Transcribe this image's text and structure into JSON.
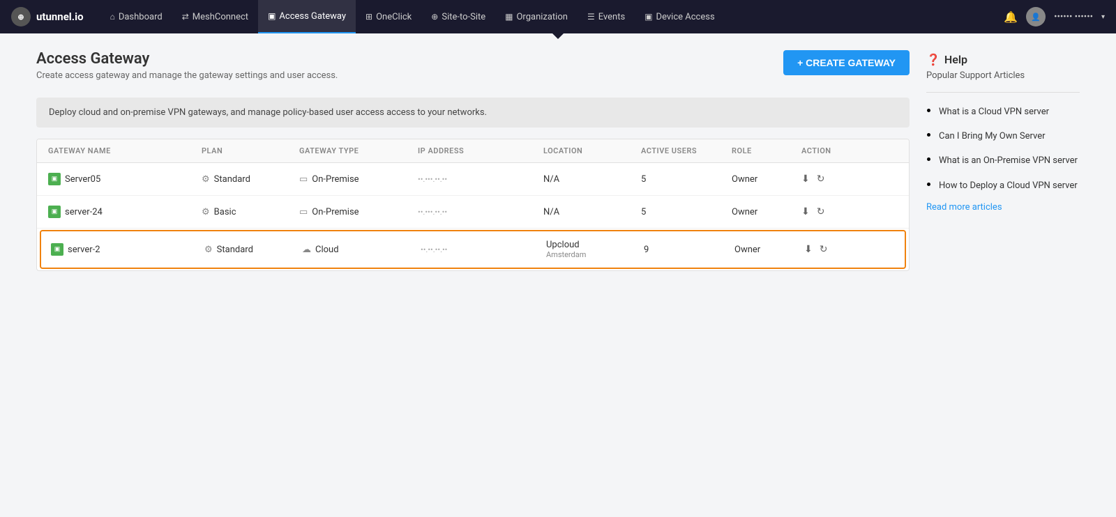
{
  "app": {
    "logo_text": "utunnel.io",
    "logo_icon": "⊕"
  },
  "nav": {
    "items": [
      {
        "id": "dashboard",
        "label": "Dashboard",
        "icon": "⌂",
        "active": false
      },
      {
        "id": "meshconnect",
        "label": "MeshConnect",
        "icon": "⇄",
        "active": false
      },
      {
        "id": "access-gateway",
        "label": "Access Gateway",
        "icon": "▣",
        "active": true
      },
      {
        "id": "oneclick",
        "label": "OneClick",
        "icon": "⊞",
        "active": false
      },
      {
        "id": "site-to-site",
        "label": "Site-to-Site",
        "icon": "⊕",
        "active": false
      },
      {
        "id": "organization",
        "label": "Organization",
        "icon": "▦",
        "active": false
      },
      {
        "id": "events",
        "label": "Events",
        "icon": "☰",
        "active": false
      },
      {
        "id": "device-access",
        "label": "Device Access",
        "icon": "▣",
        "active": false
      }
    ],
    "username": "••••••  ••••••",
    "bell_label": "🔔"
  },
  "page": {
    "title": "Access Gateway",
    "subtitle": "Create access gateway and manage the gateway settings and user access.",
    "create_button": "+ CREATE GATEWAY",
    "info_banner": "Deploy cloud and on-premise VPN gateways, and manage policy-based user access access to your networks."
  },
  "table": {
    "columns": [
      "GATEWAY NAME",
      "PLAN",
      "GATEWAY TYPE",
      "IP ADDRESS",
      "LOCATION",
      "ACTIVE USERS",
      "ROLE",
      "ACTION"
    ],
    "rows": [
      {
        "id": "row1",
        "name": "Server05",
        "plan": "Standard",
        "gateway_type": "On-Premise",
        "ip_address": "••.•••.••.••",
        "location": "N/A",
        "location_sub": "",
        "active_users": "5",
        "role": "Owner",
        "selected": false
      },
      {
        "id": "row2",
        "name": "server-24",
        "plan": "Basic",
        "gateway_type": "On-Premise",
        "ip_address": "••.•••.••.••",
        "location": "N/A",
        "location_sub": "",
        "active_users": "5",
        "role": "Owner",
        "selected": false
      },
      {
        "id": "row3",
        "name": "server-2",
        "plan": "Standard",
        "gateway_type": "Cloud",
        "ip_address": "••.••.••.••",
        "location": "Upcloud",
        "location_sub": "Amsterdam",
        "active_users": "9",
        "role": "Owner",
        "selected": true
      }
    ]
  },
  "help": {
    "title": "Help",
    "popular_label": "Popular Support Articles",
    "articles": [
      "What is a Cloud VPN server",
      "Can I Bring My Own Server",
      "What is an On-Premise VPN server",
      "How to Deploy a Cloud VPN server"
    ],
    "read_more": "Read more articles"
  }
}
